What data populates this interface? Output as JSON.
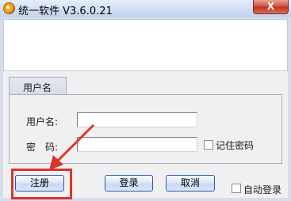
{
  "window": {
    "title": "统一软件 V3.6.0.21",
    "close_glyph": "X"
  },
  "login_group": {
    "tab_label": "用户名",
    "username_label": "用户名:",
    "username_value": "",
    "password_label": "密　码:",
    "password_value": "",
    "remember_label": "记住密码",
    "remember_checked": false
  },
  "buttons": {
    "register": "注册",
    "login": "登录",
    "cancel": "取消"
  },
  "auto_login": {
    "label": "自动登录",
    "checked": false
  },
  "annotation": {
    "highlight_color": "#e0312d"
  }
}
